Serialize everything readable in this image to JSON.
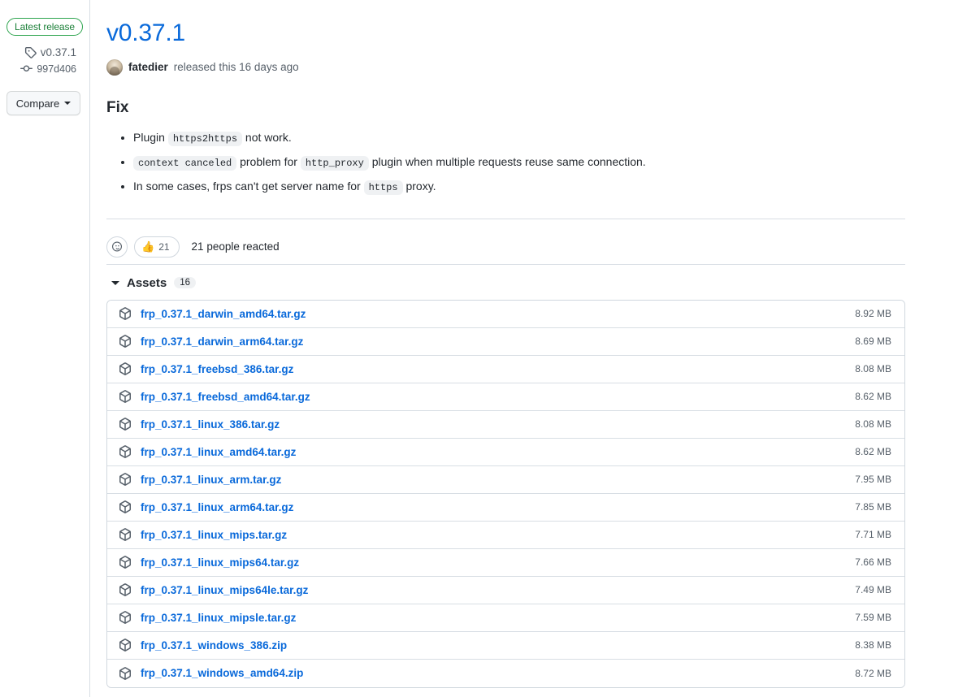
{
  "sidebar": {
    "latest_badge": "Latest release",
    "tag_icon": "tag-icon",
    "tag_name": "v0.37.1",
    "commit_icon": "commit-icon",
    "commit_sha": "997d406",
    "compare_label": "Compare",
    "compare_caret_icon": "chevron-down-icon"
  },
  "release": {
    "title": "v0.37.1",
    "author": "fatedier",
    "byline_suffix": "released this 16 days ago",
    "avatar_icon": "avatar"
  },
  "body": {
    "heading": "Fix",
    "items": [
      [
        {
          "t": "text",
          "v": "Plugin "
        },
        {
          "t": "code",
          "v": "https2https"
        },
        {
          "t": "text",
          "v": " not work."
        }
      ],
      [
        {
          "t": "code",
          "v": "context canceled"
        },
        {
          "t": "text",
          "v": " problem for "
        },
        {
          "t": "code",
          "v": "http_proxy"
        },
        {
          "t": "text",
          "v": " plugin when multiple requests reuse same connection."
        }
      ],
      [
        {
          "t": "text",
          "v": "In some cases, frps can't get server name for "
        },
        {
          "t": "code",
          "v": "https"
        },
        {
          "t": "text",
          "v": " proxy."
        }
      ]
    ]
  },
  "reactions": {
    "add_icon": "smiley-face-icon",
    "thumbsup_emoji": "👍",
    "thumbsup_count": "21",
    "summary": "21 people reacted"
  },
  "assets": {
    "toggle_icon": "triangle-down-icon",
    "label": "Assets",
    "count": "16",
    "row_icon": "package-icon",
    "rows": [
      {
        "name": "frp_0.37.1_darwin_amd64.tar.gz",
        "size": "8.92 MB"
      },
      {
        "name": "frp_0.37.1_darwin_arm64.tar.gz",
        "size": "8.69 MB"
      },
      {
        "name": "frp_0.37.1_freebsd_386.tar.gz",
        "size": "8.08 MB"
      },
      {
        "name": "frp_0.37.1_freebsd_amd64.tar.gz",
        "size": "8.62 MB"
      },
      {
        "name": "frp_0.37.1_linux_386.tar.gz",
        "size": "8.08 MB"
      },
      {
        "name": "frp_0.37.1_linux_amd64.tar.gz",
        "size": "8.62 MB"
      },
      {
        "name": "frp_0.37.1_linux_arm.tar.gz",
        "size": "7.95 MB"
      },
      {
        "name": "frp_0.37.1_linux_arm64.tar.gz",
        "size": "7.85 MB"
      },
      {
        "name": "frp_0.37.1_linux_mips.tar.gz",
        "size": "7.71 MB"
      },
      {
        "name": "frp_0.37.1_linux_mips64.tar.gz",
        "size": "7.66 MB"
      },
      {
        "name": "frp_0.37.1_linux_mips64le.tar.gz",
        "size": "7.49 MB"
      },
      {
        "name": "frp_0.37.1_linux_mipsle.tar.gz",
        "size": "7.59 MB"
      },
      {
        "name": "frp_0.37.1_windows_386.zip",
        "size": "8.38 MB"
      },
      {
        "name": "frp_0.37.1_windows_amd64.zip",
        "size": "8.72 MB"
      }
    ]
  },
  "colors": {
    "link": "#0969da",
    "green": "#1a7f37",
    "muted": "#57606a",
    "border": "#d8dee4"
  }
}
